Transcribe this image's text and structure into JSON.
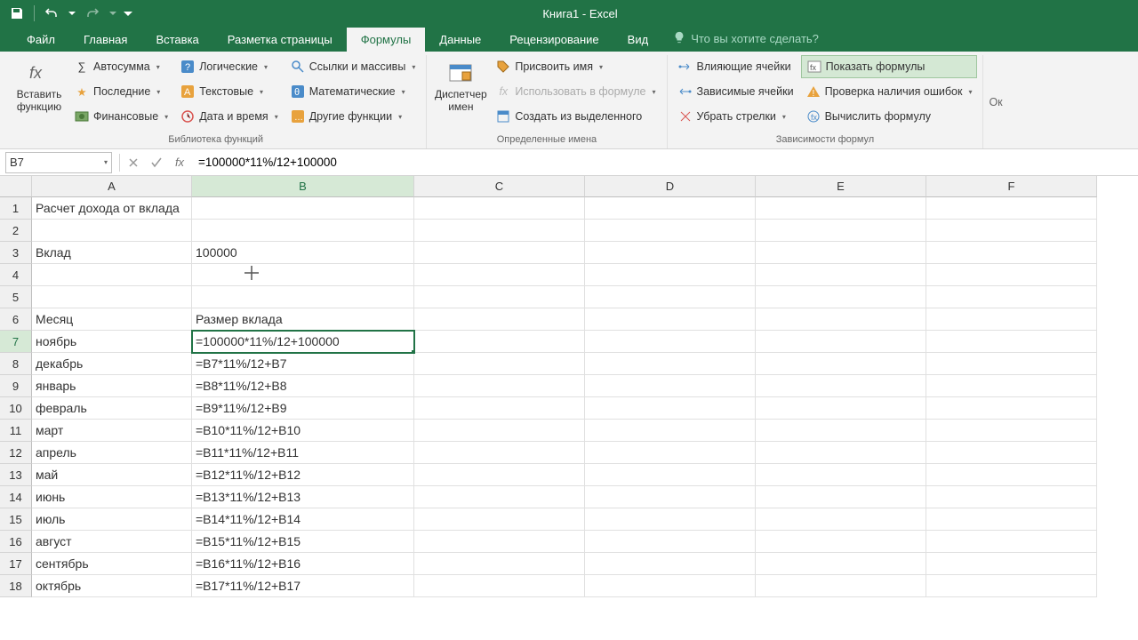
{
  "app": {
    "title": "Книга1 - Excel"
  },
  "tabs": {
    "file": "Файл",
    "home": "Главная",
    "insert": "Вставка",
    "pagelayout": "Разметка страницы",
    "formulas": "Формулы",
    "data": "Данные",
    "review": "Рецензирование",
    "view": "Вид",
    "tellme": "Что вы хотите сделать?"
  },
  "ribbon": {
    "insert_function": "Вставить функцию",
    "autosum": "Автосумма",
    "recent": "Последние",
    "financial": "Финансовые",
    "logical": "Логические",
    "text_fn": "Текстовые",
    "datetime": "Дата и время",
    "lookup": "Ссылки и массивы",
    "math": "Математические",
    "more_fn": "Другие функции",
    "library_label": "Библиотека функций",
    "name_mgr": "Диспетчер имен",
    "def_name": "Присвоить имя",
    "use_in_formula": "Использовать в формуле",
    "create_from_sel": "Создать из выделенного",
    "defined_names_label": "Определенные имена",
    "trace_prec": "Влияющие ячейки",
    "trace_dep": "Зависимые ячейки",
    "remove_arrows": "Убрать стрелки",
    "show_formulas": "Показать формулы",
    "error_check": "Проверка наличия ошибок",
    "eval_formula": "Вычислить формулу",
    "audit_label": "Зависимости формул",
    "watch_clip": "Ок"
  },
  "namebox": "B7",
  "formula": "=100000*11%/12+100000",
  "columns": [
    "A",
    "B",
    "C",
    "D",
    "E",
    "F"
  ],
  "rows": [
    {
      "n": 1,
      "A": "Расчет дохода от вклада",
      "B": ""
    },
    {
      "n": 2,
      "A": "",
      "B": ""
    },
    {
      "n": 3,
      "A": "Вклад",
      "B": "100000"
    },
    {
      "n": 4,
      "A": "",
      "B": ""
    },
    {
      "n": 5,
      "A": "",
      "B": ""
    },
    {
      "n": 6,
      "A": "Месяц",
      "B": "Размер вклада"
    },
    {
      "n": 7,
      "A": "ноябрь",
      "B": "=100000*11%/12+100000"
    },
    {
      "n": 8,
      "A": "декабрь",
      "B": "=B7*11%/12+B7"
    },
    {
      "n": 9,
      "A": "январь",
      "B": "=B8*11%/12+B8"
    },
    {
      "n": 10,
      "A": "февраль",
      "B": "=B9*11%/12+B9"
    },
    {
      "n": 11,
      "A": "март",
      "B": "=B10*11%/12+B10"
    },
    {
      "n": 12,
      "A": "апрель",
      "B": "=B11*11%/12+B11"
    },
    {
      "n": 13,
      "A": "май",
      "B": "=B12*11%/12+B12"
    },
    {
      "n": 14,
      "A": "июнь",
      "B": "=B13*11%/12+B13"
    },
    {
      "n": 15,
      "A": "июль",
      "B": "=B14*11%/12+B14"
    },
    {
      "n": 16,
      "A": "август",
      "B": "=B15*11%/12+B15"
    },
    {
      "n": 17,
      "A": "сентябрь",
      "B": "=B16*11%/12+B16"
    },
    {
      "n": 18,
      "A": "октябрь",
      "B": "=B17*11%/12+B17"
    }
  ],
  "selected": {
    "row": 7,
    "col": "B"
  },
  "chart_data": {
    "type": "table",
    "title": "Расчет дохода от вклада",
    "principal": 100000,
    "rate_annual_pct": 11,
    "columns": [
      "Месяц",
      "Размер вклада"
    ],
    "rows": [
      [
        "ноябрь",
        "=100000*11%/12+100000"
      ],
      [
        "декабрь",
        "=B7*11%/12+B7"
      ],
      [
        "январь",
        "=B8*11%/12+B8"
      ],
      [
        "февраль",
        "=B9*11%/12+B9"
      ],
      [
        "март",
        "=B10*11%/12+B10"
      ],
      [
        "апрель",
        "=B11*11%/12+B11"
      ],
      [
        "май",
        "=B12*11%/12+B12"
      ],
      [
        "июнь",
        "=B13*11%/12+B13"
      ],
      [
        "июль",
        "=B14*11%/12+B14"
      ],
      [
        "август",
        "=B15*11%/12+B15"
      ],
      [
        "сентябрь",
        "=B16*11%/12+B16"
      ],
      [
        "октябрь",
        "=B17*11%/12+B17"
      ]
    ]
  }
}
